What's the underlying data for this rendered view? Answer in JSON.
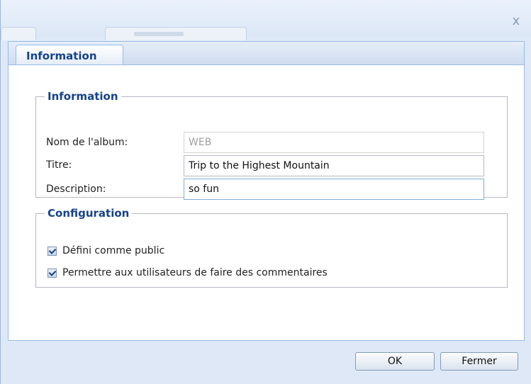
{
  "window": {
    "close_glyph": "x"
  },
  "tabs": [
    {
      "label": "Information",
      "active": true
    }
  ],
  "information": {
    "legend": "Information",
    "album_name": {
      "label": "Nom de l'album:",
      "value": "WEB"
    },
    "title": {
      "label": "Titre:",
      "value": "Trip to the Highest Mountain"
    },
    "description": {
      "label": "Description:",
      "value": "so fun"
    }
  },
  "configuration": {
    "legend": "Configuration",
    "options": [
      {
        "label": "Défini comme public",
        "checked": true
      },
      {
        "label": "Permettre aux utilisateurs de faire des commentaires",
        "checked": true
      }
    ]
  },
  "buttons": {
    "ok": "OK",
    "close": "Fermer"
  },
  "colors": {
    "accent": "#15428b",
    "frame": "#dfe8f6",
    "border": "#99bbe8"
  }
}
